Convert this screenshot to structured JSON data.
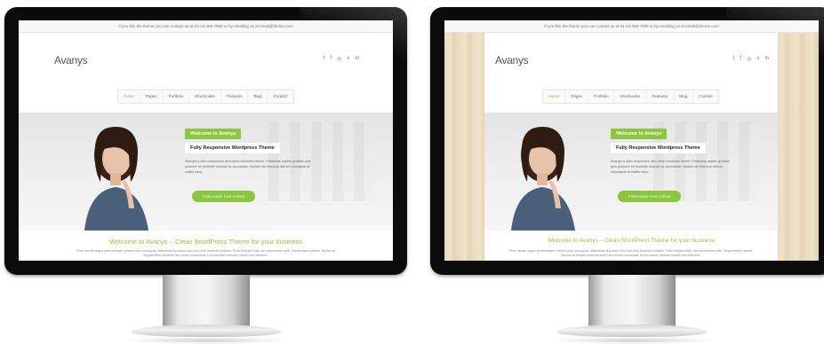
{
  "topbar_text": "If you like the theme you can contact us at 01-23-456-7890 or by emailing us at email@theme.com",
  "site": {
    "logo": "Avanys",
    "social_icons": [
      "twitter-icon",
      "facebook-icon",
      "dribbble-icon",
      "vimeo-icon",
      "linkedin-icon"
    ],
    "nav": [
      "Home",
      "Pages",
      "Portfolio",
      "Shortcodes",
      "Features",
      "Blog",
      "Contact"
    ],
    "hero": {
      "badge": "Welcome to Avanys",
      "subtitle": "Fully Responsive Wordpress Theme",
      "description": "Avanys is ultra responsive and clean business theme. Phasellus sapien gravida quis posuere mi molestie suscipit ac accumsan. Nullam vel rhoncus dictum consequat at mattis risus.",
      "button": "PURCHASE THIS THEME"
    },
    "welcome_heading": "Welcome to Avanys – Clean WordPress Theme for your business",
    "body_text": "Proin iaculis augue pellentesque ultrices odio consequat. Maecenas tincidunt nunc sed eros tincidunt sodales. Proin tristique felis, non elementum velit. Suspendisse potenti. Nullam at fringilla tellus sit amet nisl viverra consequat. Ut accumsan ultricies mauris sed interdum."
  },
  "colors": {
    "accent": "#8cc63f",
    "wood_background": "#e9dbbf"
  }
}
